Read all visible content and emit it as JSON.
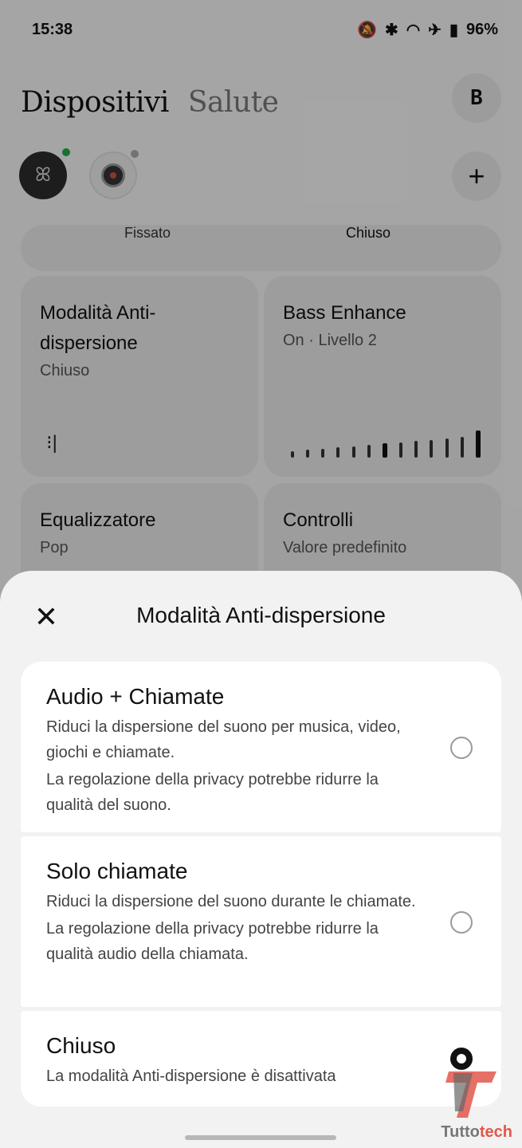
{
  "status_bar": {
    "time": "15:38",
    "battery": "96%",
    "icons": [
      "bell-off-icon",
      "bluetooth-icon",
      "wifi-icon",
      "airplane-icon",
      "battery-icon"
    ]
  },
  "header": {
    "tabs": [
      {
        "label": "Dispositivi",
        "active": true
      },
      {
        "label": "Salute",
        "active": false
      }
    ],
    "profile_initial": "B"
  },
  "devices": [
    {
      "name": "earbuds",
      "status": "connected",
      "status_color": "#22a748"
    },
    {
      "name": "watch",
      "status": "disconnected",
      "status_color": "#aaaaaa"
    }
  ],
  "status_pill": {
    "left": "Fissato",
    "right": "Chiuso"
  },
  "cards": [
    {
      "title": "Modalità Anti-dispersione",
      "subtitle": "Chiuso"
    },
    {
      "title": "Bass Enhance",
      "subtitle": "On · Livello 2",
      "level": 2
    },
    {
      "title": "Equalizzatore",
      "subtitle": "Pop"
    },
    {
      "title": "Controlli",
      "subtitle": "Valore predefinito"
    }
  ],
  "sheet": {
    "title": "Modalità Anti-dispersione",
    "options": [
      {
        "title": "Audio + Chiamate",
        "desc1": "Riduci la dispersione del suono per musica, video, giochi e chiamate.",
        "desc2": "La regolazione della privacy potrebbe ridurre la qualità del suono.",
        "selected": false
      },
      {
        "title": "Solo chiamate",
        "desc1": "Riduci la dispersione del suono durante le chiamate.",
        "desc2": "La regolazione della privacy potrebbe ridurre la qualità audio della chiamata.",
        "selected": false
      },
      {
        "title": "Chiuso",
        "desc1": "La modalità Anti-dispersione è disattivata",
        "selected": true
      }
    ]
  },
  "watermark": {
    "text_a": "Tutto",
    "text_b": "tech",
    "accent": "#e2574c"
  }
}
